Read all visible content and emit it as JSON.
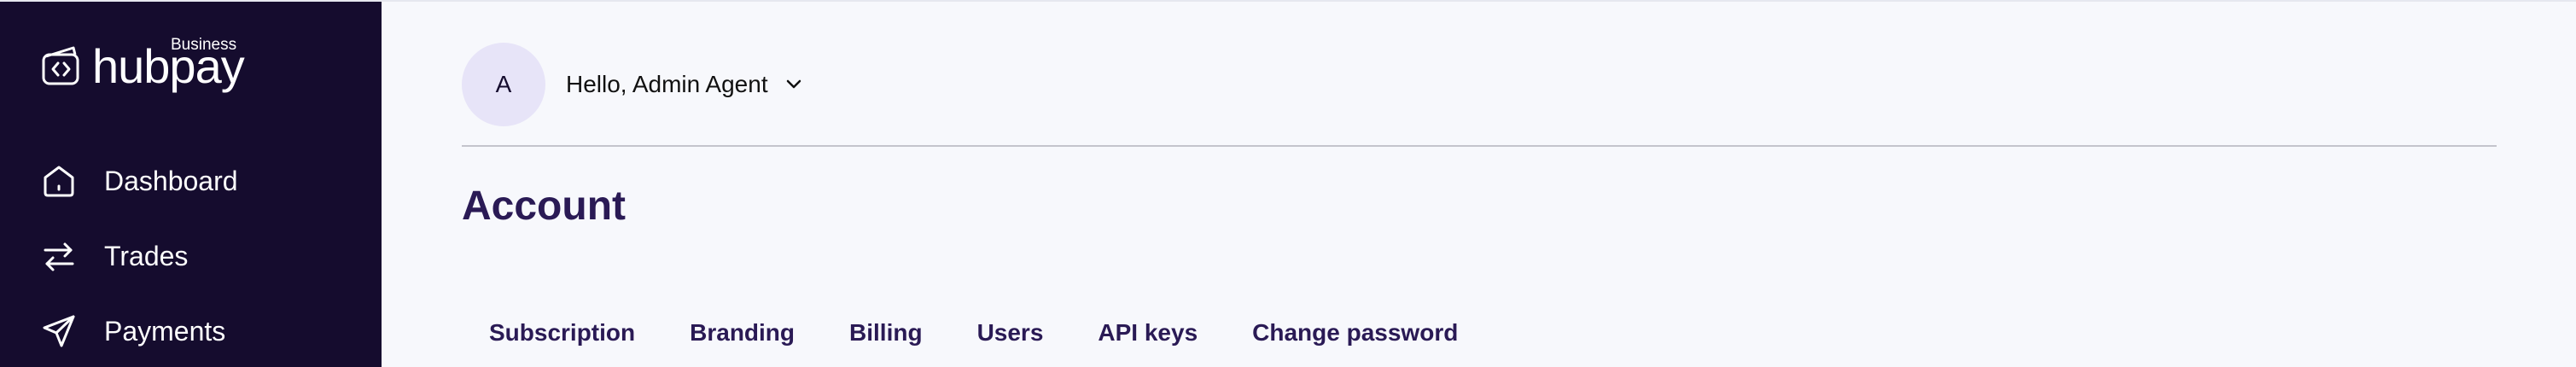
{
  "brand": {
    "name": "hubpay",
    "sub": "Business"
  },
  "sidebar": {
    "items": [
      {
        "label": "Dashboard",
        "icon": "home-icon"
      },
      {
        "label": "Trades",
        "icon": "swap-arrows-icon"
      },
      {
        "label": "Payments",
        "icon": "send-icon"
      }
    ]
  },
  "header": {
    "avatar_initial": "A",
    "greeting": "Hello, Admin Agent"
  },
  "page": {
    "title": "Account"
  },
  "tabs": [
    {
      "label": "Subscription"
    },
    {
      "label": "Branding"
    },
    {
      "label": "Billing"
    },
    {
      "label": "Users"
    },
    {
      "label": "API keys"
    },
    {
      "label": "Change password"
    }
  ],
  "colors": {
    "sidebar_bg": "#150c2e",
    "page_bg": "#f7f8fc",
    "accent_text": "#2a1a55",
    "avatar_bg": "#e7e4f8"
  }
}
